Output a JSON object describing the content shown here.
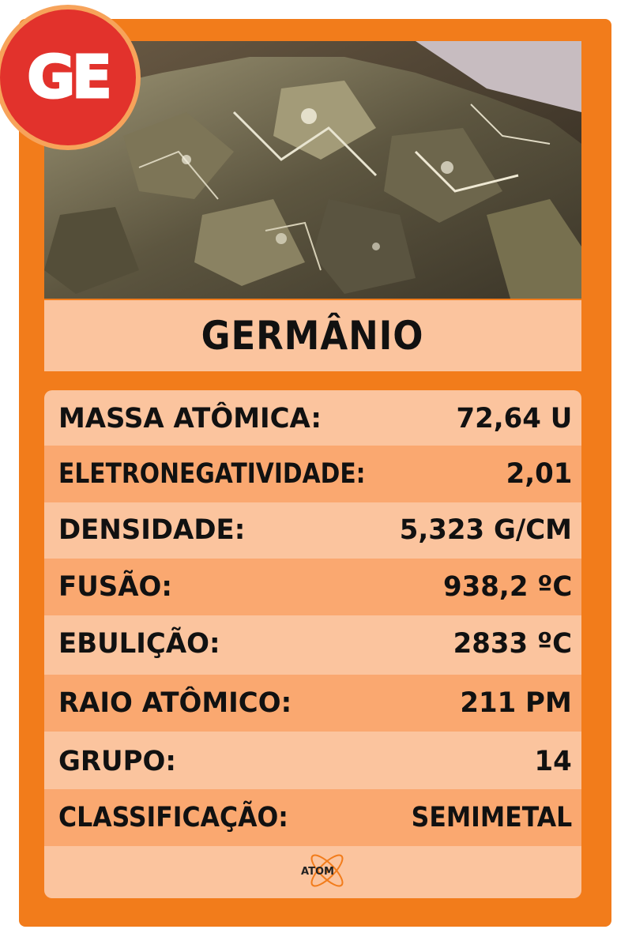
{
  "symbol": "GE",
  "element_name": "GERMÂNIO",
  "properties": [
    {
      "label": "MASSA ATÔMICA:",
      "value": "72,64 U"
    },
    {
      "label": "ELETRONEGATIVIDADE:",
      "value": "2,01"
    },
    {
      "label": "DENSIDADE:",
      "value": "5,323 G/CM"
    },
    {
      "label": "FUSÃO:",
      "value": "938,2 ºC"
    },
    {
      "label": "EBULIÇÃO:",
      "value": "2833 ºC"
    },
    {
      "label": "RAIO ATÔMICO:",
      "value": "211 PM"
    },
    {
      "label": "GRUPO:",
      "value": "14"
    },
    {
      "label": "CLASSIFICAÇÃO:",
      "value": "SEMIMETAL"
    }
  ],
  "logo_text": "ATOM",
  "colors": {
    "card": "#f27c1b",
    "panel": "#fbc49e",
    "row_alt": "#faa870",
    "badge": "#e2322c"
  },
  "icons": {
    "photo": "germanium-crystal-photo",
    "logo": "atom-logo"
  }
}
